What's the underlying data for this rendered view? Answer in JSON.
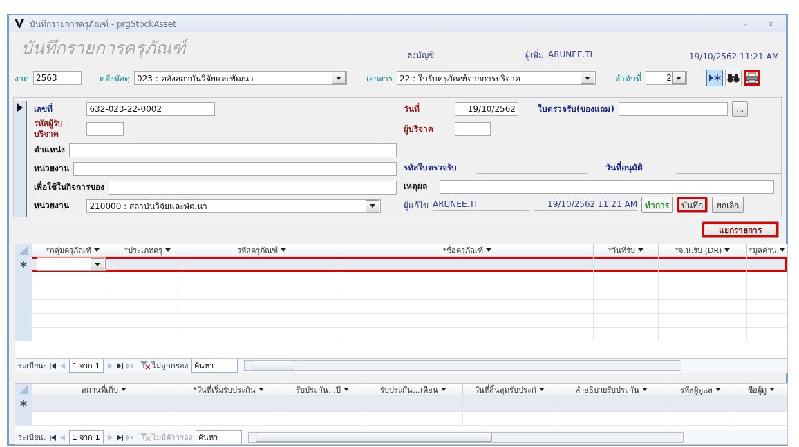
{
  "window": {
    "title": "บันทึกรายการครุภัณฑ์ - prgStockAsset",
    "controls": [
      "-",
      "x"
    ]
  },
  "header": {
    "title": "บันทึกรายการครุภัณฑ์",
    "posted_label": "ลงบัญชี",
    "added_by_label": "ผู้เพิ่ม",
    "added_by": "ARUNEE.TI",
    "added_at": "19/10/2562  11:21 AM"
  },
  "filters": [
    {
      "label": "งวด",
      "value": "2563",
      "kind": "text"
    },
    {
      "label": "คลังพัสดุ",
      "value": "023 : คลังสถาบันวิจัยและพัฒนา",
      "kind": "combo"
    },
    {
      "label": "เอกสาร",
      "value": "22 : ใบรับครุภัณฑ์จากการบริจาค",
      "kind": "combo"
    },
    {
      "label": "ลำดับที่",
      "value": "2",
      "kind": "number-combo"
    }
  ],
  "toolbar": [
    {
      "kind": "new-record",
      "selected": true,
      "highlighted": false
    },
    {
      "kind": "find",
      "selected": false,
      "highlighted": false
    },
    {
      "kind": "print",
      "selected": false,
      "highlighted": true
    }
  ],
  "form": {
    "left": [
      {
        "label": "เลขที่",
        "value": "632-023-22-0002",
        "kind": "medium",
        "color": "#1c2a8a"
      },
      {
        "label": "รหัสผู้รับบริจาค",
        "kind": "code",
        "color": "#8b1a1a"
      },
      {
        "label": "ตำแหน่ง",
        "kind": "wide",
        "color": "#111111"
      },
      {
        "label": "หน่วยงาน",
        "kind": "wide",
        "color": "#111111"
      },
      {
        "label": "เพื่อใช้ในกิจการของ",
        "kind": "wide",
        "color": "#111111"
      },
      {
        "label": "หน่วยงาน",
        "value": "210000 : สถาบันวิจัยและพัฒนา",
        "kind": "combo",
        "color": "#111111"
      }
    ],
    "date_label": "วันที่",
    "date": "19/10/2562",
    "gift_label": "ใบตรวจรับ(ของแถม)",
    "gift_button": "...",
    "donor_label": "ผู้บริจาค",
    "receipt_code_label": "รหัสใบตรวจรับ",
    "approved_label": "วันที่อนุมัติ",
    "reason_label": "เหตุผล",
    "editor_label": "ผู้แก้ไข",
    "editor": "ARUNEE.TI",
    "edited_at": "19/10/2562  11:21 AM",
    "actions": [
      {
        "label": "ทำการ",
        "kind": "status"
      },
      {
        "label": "บันทึก",
        "kind": "button",
        "highlighted": true
      },
      {
        "label": "ยกเลิก",
        "kind": "button",
        "highlighted": false
      }
    ]
  },
  "split_button": {
    "label": "แยกรายการ",
    "highlighted": true
  },
  "grids": [
    {
      "columns": [
        "*กลุ่มครุภัณฑ์",
        "*ประเภทครุ",
        "รหัสครุภัณฑ์",
        "*ชื่อครุภัณฑ์",
        "*วันที่รับ",
        "*จ.น.รับ (DR)",
        "*มูลค่าน่"
      ],
      "new_row_highlighted": true,
      "nav": {
        "label": "ระเบียน:",
        "position": "1 จาก 1",
        "filter": "ไม่ถูกกรอง",
        "filter_disabled": false,
        "search": "ค้นหา"
      }
    },
    {
      "columns": [
        "สถานที่เก็บ",
        "*วันที่เริ่มรับประกัน",
        "รับประกัน...ปี",
        "รับประกัน...เดือน",
        "วันที่สิ้นสุดรับประกั",
        "คำอธิบายรับประกัน",
        "รหัสผู้ดูแล",
        "ชื่อผู้ดู"
      ],
      "new_row_highlighted": false,
      "nav": {
        "label": "ระเบียน:",
        "position": "1 จาก 1",
        "filter": "ไม่มีตัวกรอง",
        "filter_disabled": true,
        "search": "ค้นหา"
      }
    }
  ]
}
